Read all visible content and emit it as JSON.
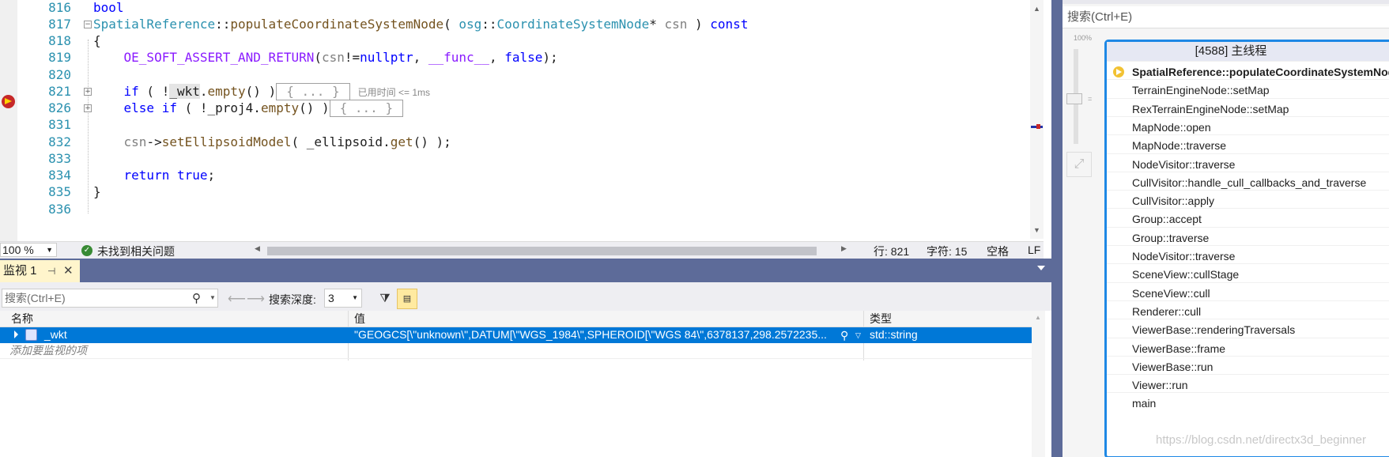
{
  "editor": {
    "lines": [
      {
        "n": "816",
        "html": "<span class=\"kw\">bool</span>"
      },
      {
        "n": "817",
        "html": "<span class=\"ty\">SpatialReference</span>::<span class=\"fn\">populateCoordinateSystemNode</span>( <span class=\"ty\">osg</span>::<span class=\"ty\">CoordinateSystemNode</span>* <span class=\"pm\">csn</span> ) <span class=\"kw\">const</span>"
      },
      {
        "n": "818",
        "html": "{"
      },
      {
        "n": "819",
        "html": "    <span class=\"mc\">OE_SOFT_ASSERT_AND_RETURN</span>(<span class=\"pm\">csn</span>!=<span class=\"kw\">nullptr</span>, <span class=\"mc\">__func__</span>, <span class=\"kw\">false</span>);"
      },
      {
        "n": "820",
        "html": ""
      },
      {
        "n": "821",
        "html": "    <span class=\"kw\">if</span> ( !<span class=\"hl\">_wkt</span>.<span class=\"fn\">empty</span>() )<span class=\"collapsed-box\">{ ... }</span><span class=\"perf\">已用时间 &lt;= 1ms</span>"
      },
      {
        "n": "826",
        "html": "    <span class=\"kw\">else if</span> ( !_proj4.<span class=\"fn\">empty</span>() )<span class=\"collapsed-box\">{ ... }</span>"
      },
      {
        "n": "831",
        "html": ""
      },
      {
        "n": "832",
        "html": "    <span class=\"pm\">csn</span>-&gt;<span class=\"fn\">setEllipsoidModel</span>( _ellipsoid.<span class=\"fn\">get</span>() );"
      },
      {
        "n": "833",
        "html": ""
      },
      {
        "n": "834",
        "html": "    <span class=\"kw\">return</span> <span class=\"kw\">true</span>;"
      },
      {
        "n": "835",
        "html": "}"
      },
      {
        "n": "836",
        "html": ""
      }
    ]
  },
  "statusbar": {
    "zoom": "100 %",
    "issues": "未找到相关问题",
    "row": "行: 821",
    "char": "字符: 15",
    "space": "空格",
    "eol": "LF"
  },
  "watch": {
    "tab_title": "监视 1",
    "pin_glyph": "⊣",
    "close_glyph": "✕",
    "search_placeholder": "搜索(Ctrl+E)",
    "depth_label": "搜索深度:",
    "depth_value": "3",
    "columns": {
      "name": "名称",
      "value": "值",
      "type": "类型"
    },
    "rows": [
      {
        "name": "_wkt",
        "value": "\"GEOGCS[\\\"unknown\\\",DATUM[\\\"WGS_1984\\\",SPHEROID[\\\"WGS 84\\\",6378137,298.2572235...",
        "type": "std::string"
      }
    ],
    "add_text": "添加要监视的项"
  },
  "right_pane": {
    "search": "搜索(Ctrl+E)",
    "zoom_pct": "100%",
    "thread_title": "[4588] 主线程",
    "frames": [
      "SpatialReference::populateCoordinateSystemNode",
      "TerrainEngineNode::setMap",
      "RexTerrainEngineNode::setMap",
      "MapNode::open",
      "MapNode::traverse",
      "NodeVisitor::traverse",
      "CullVisitor::handle_cull_callbacks_and_traverse",
      "CullVisitor::apply",
      "Group::accept",
      "Group::traverse",
      "NodeVisitor::traverse",
      "SceneView::cullStage",
      "SceneView::cull",
      "Renderer::cull",
      "ViewerBase::renderingTraversals",
      "ViewerBase::frame",
      "ViewerBase::run",
      "Viewer::run",
      "main"
    ],
    "watermark": "https://blog.csdn.net/directx3d_beginner"
  }
}
